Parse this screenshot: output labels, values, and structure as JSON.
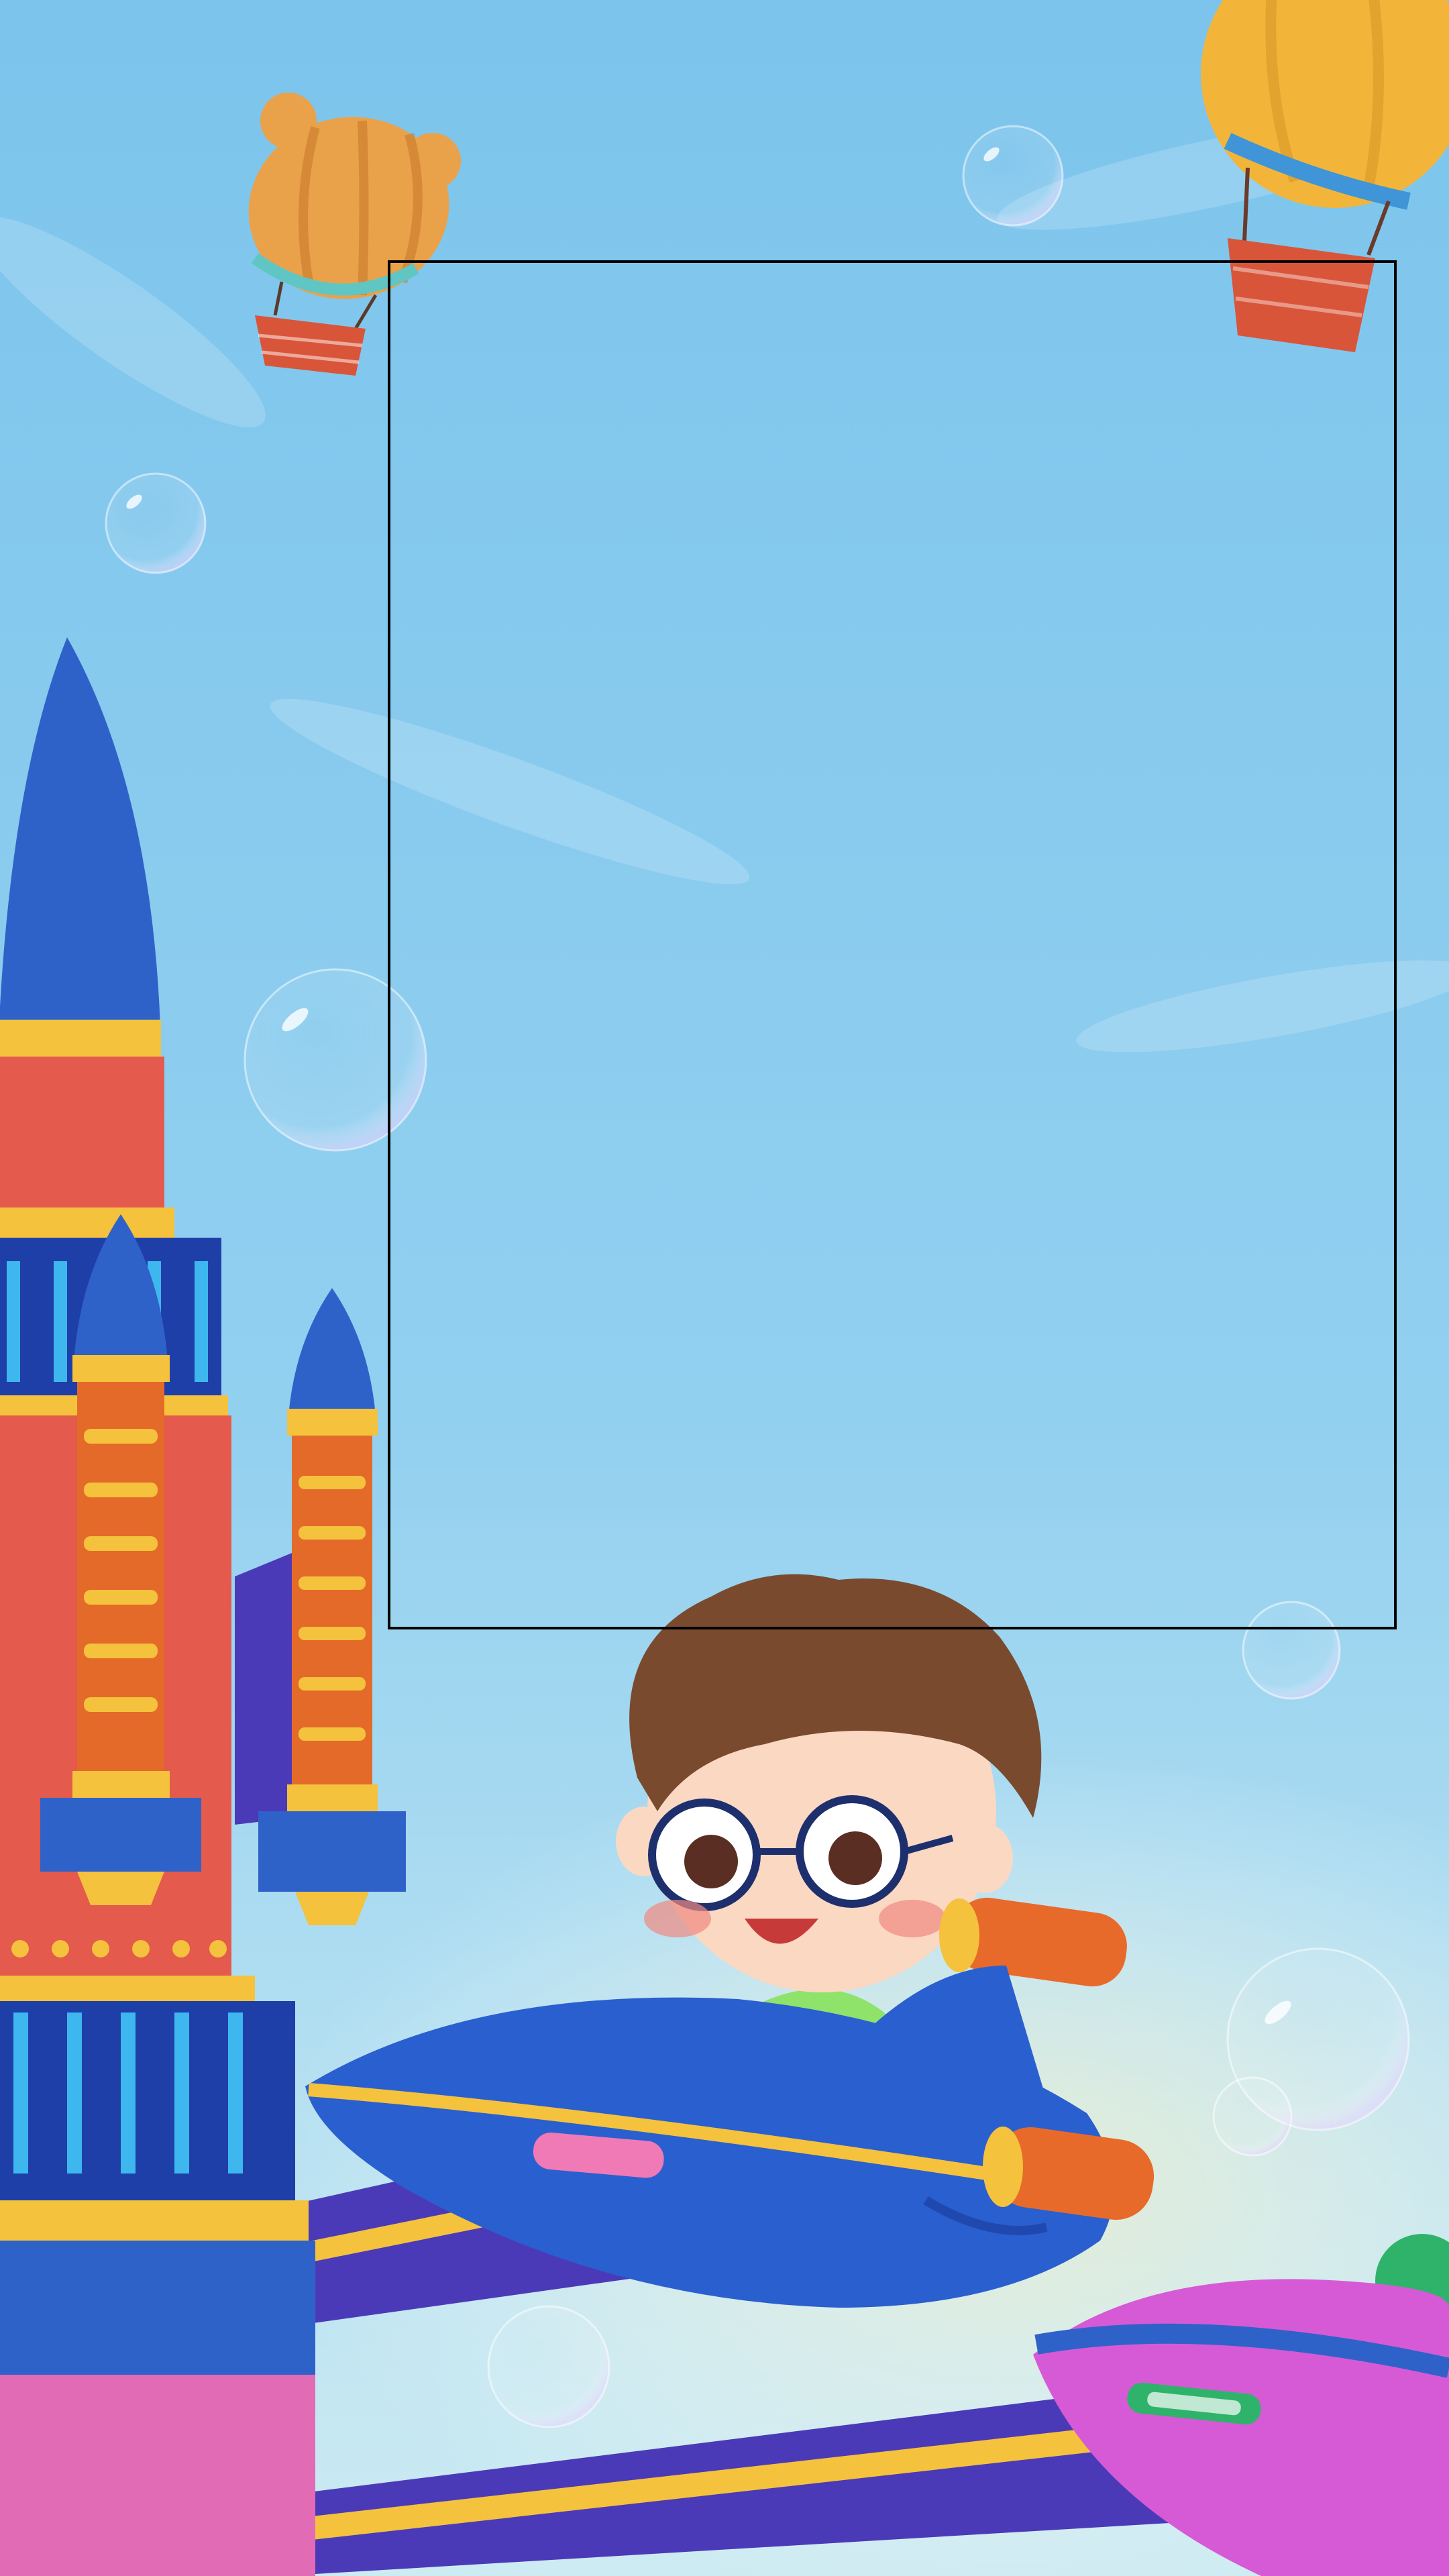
{
  "palette": {
    "sky_top": "#7cc4ec",
    "sky_mid": "#92d0f0",
    "sky_bottom": "#cdebf2",
    "haze": "#f3f0c8",
    "frame_stroke": "#000000",
    "rocket_blue": "#2f62c9",
    "rocket_dark_blue": "#1f3fa8",
    "rocket_red": "#e45a4c",
    "rocket_orange": "#e46a2a",
    "rocket_yellow": "#f4c23c",
    "rocket_pink": "#e26bb6",
    "track_purple": "#4b3ab8",
    "plane_blue": "#2a5fd0",
    "plane_orange": "#e86a2a",
    "ufo_magenta": "#d65ad6",
    "ufo_green": "#2fb36a",
    "balloon_orange": "#e9a24a",
    "balloon_yellow": "#f2b53a",
    "balloon_basket": "#d9553a",
    "hair_brown": "#7a4a2e",
    "skin": "#fbd8c2",
    "shirt_green": "#8fe26a",
    "glasses": "#1e2f6e"
  },
  "icons": [
    "bear-hot-air-balloon-icon",
    "hot-air-balloon-icon",
    "rocket-icon",
    "booster-rocket-icon",
    "airplane-icon",
    "ufo-icon",
    "bubble-icon",
    "boy-pilot-icon"
  ]
}
